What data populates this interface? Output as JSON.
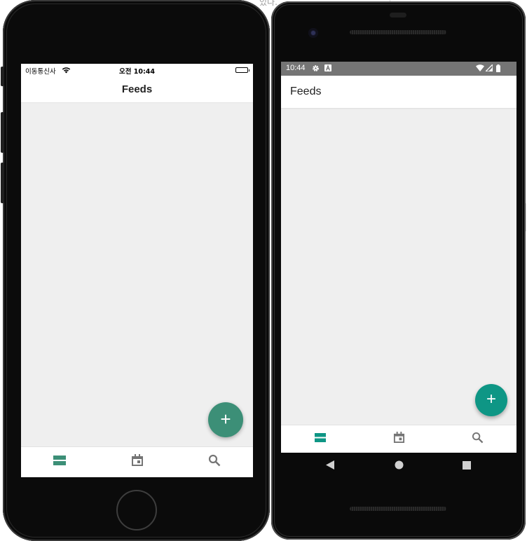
{
  "background": {
    "partial_text": "있다."
  },
  "colors": {
    "ios_accent": "#3c8f77",
    "android_accent": "#0e9685",
    "tab_inactive": "#757575",
    "screen_bg": "#efefef",
    "android_statusbar": "#757575"
  },
  "ios": {
    "status": {
      "carrier": "이동통신사",
      "time": "오전 10:44"
    },
    "header": {
      "title": "Feeds"
    },
    "fab": {
      "label": "+",
      "icon": "plus-icon"
    },
    "tabs": [
      {
        "icon": "feed-icon",
        "active": true
      },
      {
        "icon": "calendar-icon",
        "active": false
      },
      {
        "icon": "search-icon",
        "active": false
      }
    ]
  },
  "android": {
    "status": {
      "time": "10:44"
    },
    "header": {
      "title": "Feeds"
    },
    "fab": {
      "label": "+",
      "icon": "plus-icon"
    },
    "tabs": [
      {
        "icon": "feed-icon",
        "active": true
      },
      {
        "icon": "calendar-icon",
        "active": false
      },
      {
        "icon": "search-icon",
        "active": false
      }
    ],
    "nav": [
      "back-icon",
      "home-icon",
      "recents-icon"
    ]
  }
}
